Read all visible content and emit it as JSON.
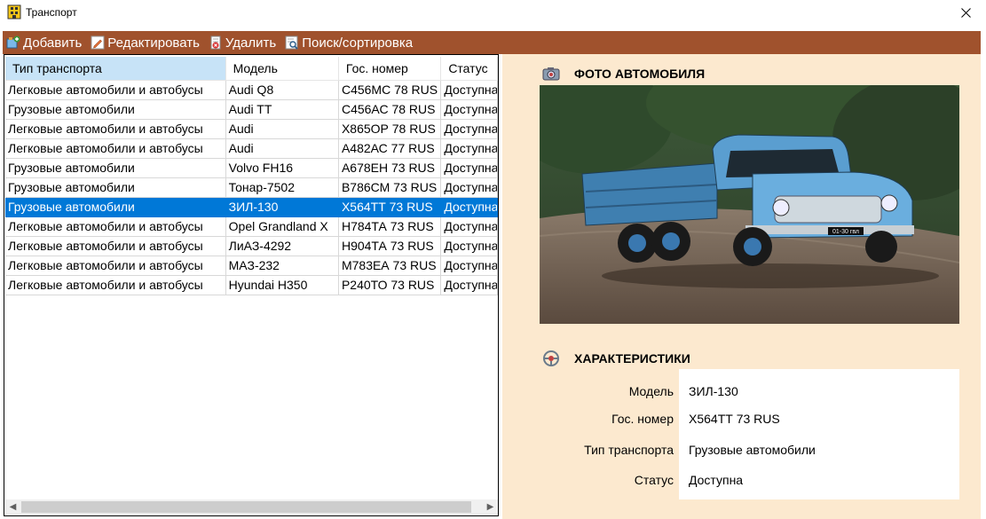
{
  "window": {
    "title": "Транспорт"
  },
  "toolbar": {
    "add_label": "Добавить",
    "edit_label": "Редактировать",
    "delete_label": "Удалить",
    "search_label": "Поиск/сортировка"
  },
  "table": {
    "headers": [
      "Тип транспорта",
      "Модель",
      "Гос. номер",
      "Статус"
    ],
    "selected_index": 6,
    "rows": [
      [
        "Легковые автомобили и автобусы",
        "Audi Q8",
        "С456МС 78 RUS",
        "Доступна"
      ],
      [
        "Грузовые автомобили",
        "Audi TT",
        "С456АС 78 RUS",
        "Доступна"
      ],
      [
        "Легковые автомобили и автобусы",
        "Audi",
        "Х865ОР 78 RUS",
        "Доступна"
      ],
      [
        "Легковые автомобили и автобусы",
        "Audi",
        "А482АС 77 RUS",
        "Доступна"
      ],
      [
        "Грузовые автомобили",
        "Volvo FH16",
        "А678ЕН 73 RUS",
        "Доступна"
      ],
      [
        "Грузовые автомобили",
        "Тонар-7502",
        "В786СМ 73 RUS",
        "Доступна"
      ],
      [
        "Грузовые автомобили",
        "ЗИЛ-130",
        "Х564ТТ 73 RUS",
        "Доступна"
      ],
      [
        "Легковые автомобили и автобусы",
        "Opel Grandland X",
        "Н784ТА 73 RUS",
        "Доступна"
      ],
      [
        "Легковые автомобили и автобусы",
        "ЛиАЗ-4292",
        "Н904ТА 73 RUS",
        "Доступна"
      ],
      [
        "Легковые автомобили и автобусы",
        "МАЗ-232",
        "М783ЕА 73 RUS",
        "Доступна"
      ],
      [
        "Легковые автомобили и автобусы",
        "Hyundai H350",
        "Р240ТО 73 RUS",
        "Доступна"
      ]
    ]
  },
  "photo_section": {
    "title": "ФОТО АВТОМОБИЛЯ",
    "plate_text": "01-30 гвл"
  },
  "characteristics": {
    "title": "ХАРАКТЕРИСТИКИ",
    "model_label": "Модель",
    "model_value": "ЗИЛ-130",
    "plate_label": "Гос. номер",
    "plate_value": "Х564ТТ 73 RUS",
    "type_label": "Тип транспорта",
    "type_value": "Грузовые автомобили",
    "status_label": "Статус",
    "status_value": "Доступна"
  },
  "colors": {
    "toolbar": "#a0522d",
    "panel": "#fce9cf",
    "selection": "#0078d7",
    "header_selected": "#c7e3f7"
  },
  "icons": {
    "app": "building-icon",
    "add": "add-icon",
    "edit": "pencil-icon",
    "delete": "delete-icon",
    "search": "search-sort-icon",
    "photo": "camera-icon",
    "chars": "steering-icon",
    "close": "close-icon"
  }
}
